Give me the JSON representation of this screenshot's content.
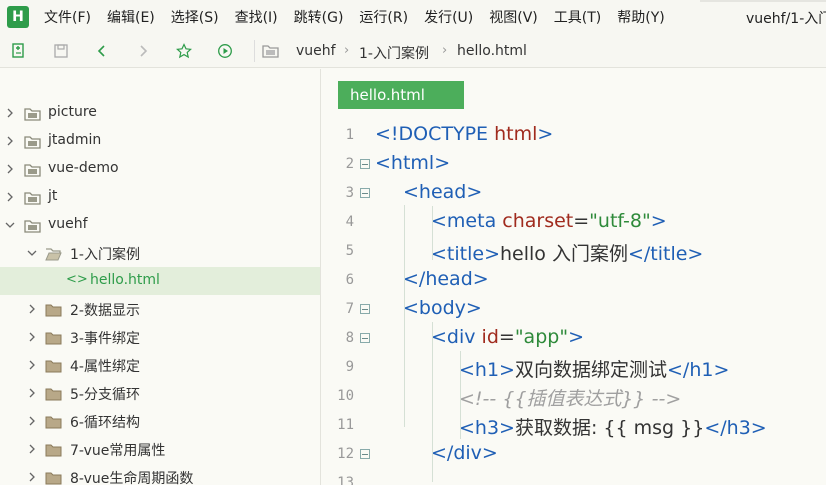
{
  "menu": {
    "logo": "H",
    "items": [
      "文件(F)",
      "编辑(E)",
      "选择(S)",
      "查找(I)",
      "跳转(G)",
      "运行(R)",
      "发行(U)",
      "视图(V)",
      "工具(T)",
      "帮助(Y)"
    ],
    "window_title": "vuehf/1-入门"
  },
  "breadcrumb": [
    "vuehf",
    "1-入门案例",
    "hello.html"
  ],
  "tree": [
    {
      "label": "picture",
      "expanded": false
    },
    {
      "label": "jtadmin",
      "expanded": false
    },
    {
      "label": "vue-demo",
      "expanded": false
    },
    {
      "label": "jt",
      "expanded": false
    },
    {
      "label": "vuehf",
      "expanded": true
    },
    {
      "label": "1-入门案例",
      "expanded": true
    },
    {
      "label": "hello.html",
      "selected": true
    },
    {
      "label": "2-数据显示",
      "expanded": false
    },
    {
      "label": "3-事件绑定",
      "expanded": false
    },
    {
      "label": "4-属性绑定",
      "expanded": false
    },
    {
      "label": "5-分支循环",
      "expanded": false
    },
    {
      "label": "6-循环结构",
      "expanded": false
    },
    {
      "label": "7-vue常用属性",
      "expanded": false
    },
    {
      "label": "8-vue生命周期函数",
      "expanded": false
    }
  ],
  "editor": {
    "tab": "hello.html",
    "line_numbers": [
      "1",
      "2",
      "3",
      "4",
      "5",
      "6",
      "7",
      "8",
      "9",
      "10",
      "11",
      "12",
      "13"
    ],
    "lines": {
      "l1": {
        "a": "<!DOCTYPE ",
        "b": "html",
        "c": ">"
      },
      "l2": {
        "a": "<html>"
      },
      "l3": {
        "a": "<head>"
      },
      "l4": {
        "a": "<meta ",
        "b": "charset",
        "c": "=",
        "d": "\"utf-8\"",
        "e": ">"
      },
      "l5": {
        "a": "<title>",
        "b": "hello 入门案例",
        "c": "</title>"
      },
      "l6": {
        "a": "</head>"
      },
      "l7": {
        "a": "<body>"
      },
      "l8": {
        "a": "<div ",
        "b": "id",
        "c": "=",
        "d": "\"app\"",
        "e": ">"
      },
      "l9": {
        "a": "<h1>",
        "b": "双向数据绑定测试",
        "c": "</h1>"
      },
      "l10": {
        "a": "<!-- {{插值表达式}} -->"
      },
      "l11": {
        "a": "<h3>",
        "b": "获取数据: {{ msg }}",
        "c": "</h3>"
      },
      "l12": {
        "a": "</div>"
      }
    }
  },
  "colors": {
    "accent": "#4cae5b",
    "selected_row": "#e3eedb",
    "tag": "#1f5fb5",
    "attr": "#a02b1e",
    "string": "#2e8a3a"
  }
}
